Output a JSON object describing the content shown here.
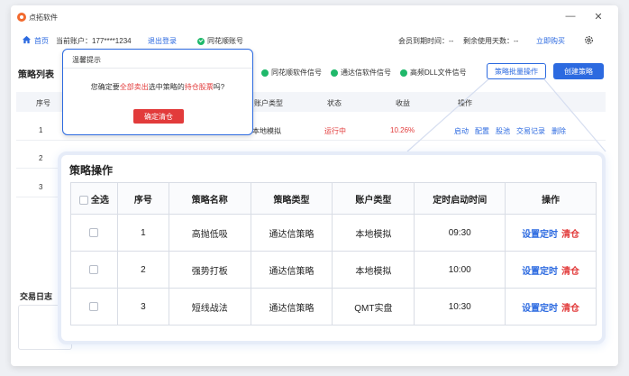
{
  "app": {
    "title": "点拓软件"
  },
  "window_controls": {
    "minimize": "—",
    "close": "✕"
  },
  "infobar": {
    "home": "首页",
    "account": "当前账户：177****1234",
    "logout": "退出登录",
    "broker": "同花顺账号",
    "expire": "会员到期时间：--",
    "days_left": "剩余使用天数：--",
    "buy": "立即购买"
  },
  "strategy_list": {
    "title": "策略列表",
    "signals": [
      "同花顺软件信号",
      "通达信软件信号",
      "高频DLL文件信号"
    ],
    "batch_button": "策略批量操作",
    "create_button": "创建策略",
    "headers": {
      "index": "序号",
      "account_type": "账户类型",
      "status": "状态",
      "profit": "收益",
      "ops": "操作"
    },
    "rows": [
      {
        "index": "1",
        "account_type": "本地模拟",
        "status": "运行中",
        "profit": "10.26%",
        "ops": [
          "启动",
          "配置",
          "股池",
          "交易记录",
          "删除"
        ]
      },
      {
        "index": "2"
      },
      {
        "index": "3"
      }
    ]
  },
  "trade_log": {
    "title": "交易日志"
  },
  "tip_popup": {
    "title": "温馨提示",
    "msg_pre": "您确定要",
    "msg_hl1": "全部卖出",
    "msg_mid": "选中策略的",
    "msg_hl2": "持仓股票",
    "msg_post": "吗?",
    "confirm": "确定清仓"
  },
  "panel": {
    "title": "策略操作",
    "headers": [
      "全选",
      "序号",
      "策略名称",
      "策略类型",
      "账户类型",
      "定时启动时间",
      "操作"
    ],
    "rows": [
      {
        "index": "1",
        "name": "高抛低吸",
        "type": "通达信策略",
        "account": "本地模拟",
        "time": "09:30",
        "set_timer": "设置定时",
        "clear": "清仓"
      },
      {
        "index": "2",
        "name": "强势打板",
        "type": "通达信策略",
        "account": "本地模拟",
        "time": "10:00",
        "set_timer": "设置定时",
        "clear": "清仓"
      },
      {
        "index": "3",
        "name": "短线战法",
        "type": "通达信策略",
        "account": "QMT实盘",
        "time": "10:30",
        "set_timer": "设置定时",
        "clear": "清仓"
      }
    ]
  },
  "colors": {
    "accent": "#2c6ae0",
    "danger": "#e23b3b",
    "signal": "#1fb86a",
    "logo": "#f26a2e"
  }
}
